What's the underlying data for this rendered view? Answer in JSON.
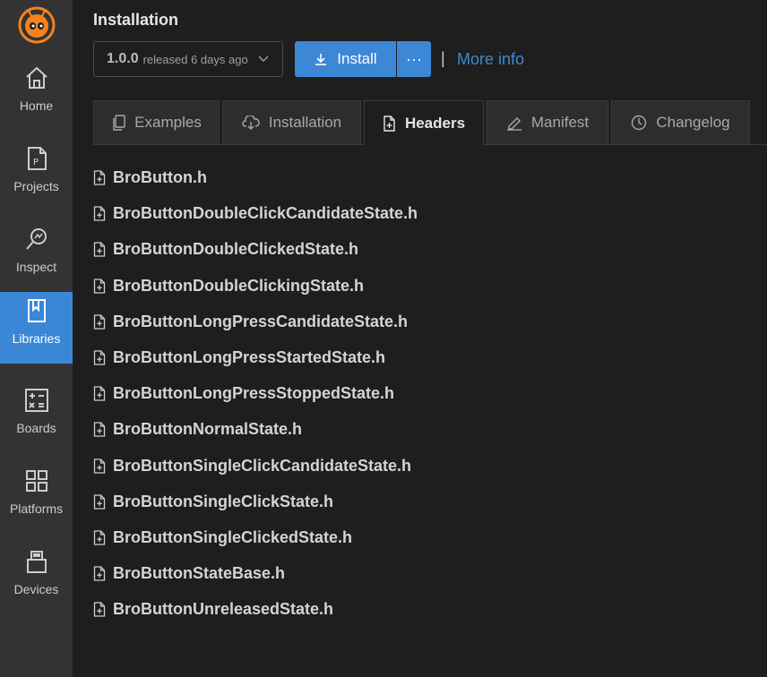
{
  "sidebar": {
    "items": [
      {
        "label": "Home",
        "icon": "home-icon"
      },
      {
        "label": "Projects",
        "icon": "project-file-icon"
      },
      {
        "label": "Inspect",
        "icon": "inspect-icon"
      },
      {
        "label": "Libraries",
        "icon": "library-bookmark-icon",
        "active": true
      },
      {
        "label": "Boards",
        "icon": "calculator-icon"
      },
      {
        "label": "Platforms",
        "icon": "grid-icon"
      },
      {
        "label": "Devices",
        "icon": "usb-icon"
      }
    ]
  },
  "header": {
    "title": "Installation",
    "version": "1.0.0",
    "released": "released 6 days ago",
    "install_label": "Install",
    "more_label": "···",
    "separator": "|",
    "more_info_label": "More info"
  },
  "tabs": [
    {
      "label": "Examples",
      "icon": "copy-icon"
    },
    {
      "label": "Installation",
      "icon": "cloud-download-icon"
    },
    {
      "label": "Headers",
      "icon": "file-plus-icon",
      "active": true
    },
    {
      "label": "Manifest",
      "icon": "edit-icon"
    },
    {
      "label": "Changelog",
      "icon": "clock-icon"
    }
  ],
  "files": [
    "BroButton.h",
    "BroButtonDoubleClickCandidateState.h",
    "BroButtonDoubleClickedState.h",
    "BroButtonDoubleClickingState.h",
    "BroButtonLongPressCandidateState.h",
    "BroButtonLongPressStartedState.h",
    "BroButtonLongPressStoppedState.h",
    "BroButtonNormalState.h",
    "BroButtonSingleClickCandidateState.h",
    "BroButtonSingleClickState.h",
    "BroButtonSingleClickedState.h",
    "BroButtonStateBase.h",
    "BroButtonUnreleasedState.h"
  ],
  "colors": {
    "accent": "#3c87d6",
    "sidebar_bg": "#333333",
    "main_bg": "#1e1e1e",
    "logo": "#f5821f"
  }
}
